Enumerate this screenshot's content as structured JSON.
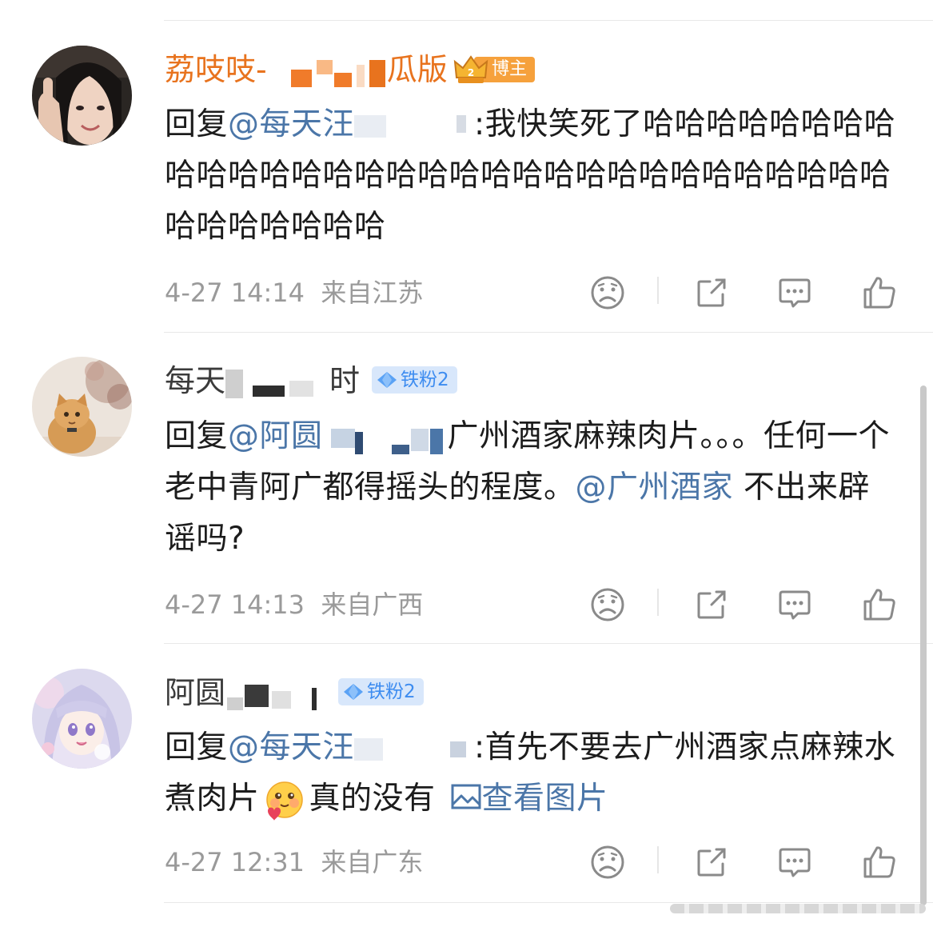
{
  "comments": [
    {
      "username_a": "荔吱吱-",
      "username_b": "瓜版",
      "badge": "博主",
      "reply_prefix": "回复",
      "mention": "@每天汪",
      "text": ":我快笑死了哈哈哈哈哈哈哈哈哈哈哈哈哈哈哈哈哈哈哈哈哈哈哈哈哈哈哈哈哈哈哈哈哈哈哈哈哈哈",
      "date": "4-27 14:14",
      "location": "来自江苏"
    },
    {
      "username_a": "每天",
      "username_b": "时",
      "badge": "铁粉2",
      "reply_prefix": "回复",
      "mention": "@阿圆",
      "text": "广州酒家麻辣肉片。。。任何一个老中青阿广都得摇头的程度。",
      "mention2": "@广州酒家",
      "text2": " 不出来辟谣吗?",
      "date": "4-27 14:13",
      "location": "来自广西"
    },
    {
      "username_a": "阿圆",
      "badge": "铁粉2",
      "reply_prefix": "回复",
      "mention": "@每天汪",
      "text": ":首先不要去广州酒家点麻辣水煮肉片",
      "text_after_emoji": "真的没有",
      "link": "查看图片",
      "date": "4-27 12:31",
      "location": "来自广东"
    }
  ],
  "icons": {
    "dislike": "sad-face-icon",
    "share": "share-icon",
    "comment": "comment-icon",
    "like": "thumbs-up-icon",
    "fan": "diamond-icon",
    "blogger": "crown-icon",
    "emoji": "blush-emoji-icon",
    "image": "image-icon"
  },
  "colors": {
    "mention": "#4b76a8",
    "username_highlight": "#e8731e",
    "meta": "#9a9a9a",
    "fan_badge_bg": "#d8e7fb",
    "fan_badge_text": "#3d8cf0",
    "blogger_badge": "#f6a13c"
  }
}
